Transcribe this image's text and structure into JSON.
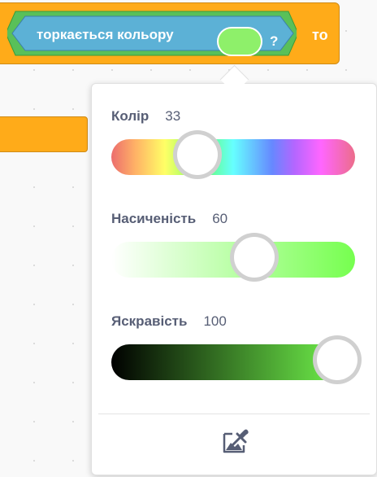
{
  "block": {
    "sensing_label": "торкається кольору",
    "question_mark": "?",
    "then_label": "то",
    "colors": {
      "control": "#ffab19",
      "sensing": "#5cb1d6",
      "motion_edge": "#59c059",
      "selected_color": "#8ef06a"
    }
  },
  "picker": {
    "hue": {
      "label": "Колір",
      "value": "33",
      "fraction": 0.33
    },
    "saturation": {
      "label": "Насиченість",
      "value": "60",
      "fraction": 0.6
    },
    "brightness": {
      "label": "Яскравість",
      "value": "100",
      "fraction": 1.0
    },
    "eyedropper_icon": "eyedropper-icon"
  }
}
